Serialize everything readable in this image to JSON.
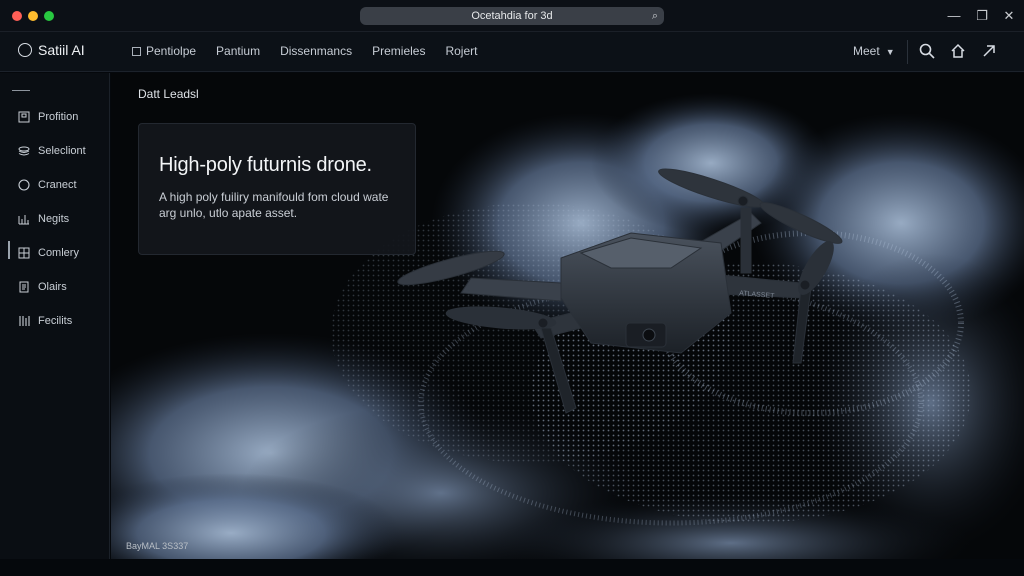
{
  "window": {
    "url_title": "Ocetahdia for 3d",
    "traffic_colors": [
      "#ff5f57",
      "#febc2e",
      "#28c840"
    ]
  },
  "topnav": {
    "brand": "Satiil AI",
    "items": [
      {
        "label": "Pentiolpe"
      },
      {
        "label": "Pantium"
      },
      {
        "label": "Dissenmancs"
      },
      {
        "label": "Premieles"
      },
      {
        "label": "Rojert"
      }
    ],
    "meet_label": "Meet",
    "icons": [
      "search-icon",
      "home-icon",
      "share-icon"
    ]
  },
  "sidebar": {
    "items": [
      {
        "label": "Profition",
        "icon": "frame-icon"
      },
      {
        "label": "Selecliont",
        "icon": "layers-icon"
      },
      {
        "label": "Cranect",
        "icon": "circle-icon"
      },
      {
        "label": "Negits",
        "icon": "chart-icon"
      },
      {
        "label": "Comlery",
        "icon": "grid-icon"
      },
      {
        "label": "Olairs",
        "icon": "doc-icon"
      },
      {
        "label": "Fecilits",
        "icon": "bars-icon"
      }
    ]
  },
  "main": {
    "section_label": "Datt Leadsl",
    "card": {
      "title": "High-poly futurnis drone.",
      "description": "A high poly fuiliry manifould fom cloud wate arg unlo, utlo apate asset."
    },
    "watermark": "BayMAL 3S337",
    "drone_label": "ATLASSET"
  }
}
